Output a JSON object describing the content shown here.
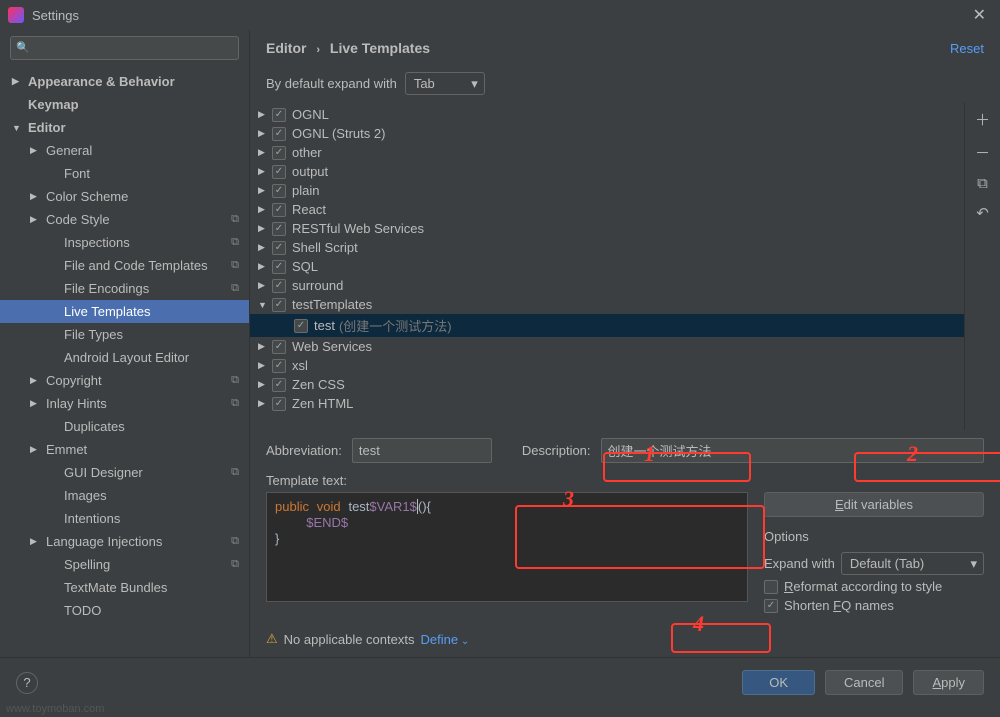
{
  "window": {
    "title": "Settings"
  },
  "search": {
    "placeholder": ""
  },
  "sidebar": {
    "items": [
      {
        "label": "Appearance & Behavior",
        "indent": 0,
        "bold": true,
        "arrow": "collapsed"
      },
      {
        "label": "Keymap",
        "indent": 0,
        "bold": true
      },
      {
        "label": "Editor",
        "indent": 0,
        "bold": true,
        "arrow": "expanded"
      },
      {
        "label": "General",
        "indent": 1,
        "arrow": "collapsed"
      },
      {
        "label": "Font",
        "indent": 2
      },
      {
        "label": "Color Scheme",
        "indent": 1,
        "arrow": "collapsed"
      },
      {
        "label": "Code Style",
        "indent": 1,
        "arrow": "collapsed",
        "copy": true
      },
      {
        "label": "Inspections",
        "indent": 2,
        "copy": true
      },
      {
        "label": "File and Code Templates",
        "indent": 2,
        "copy": true
      },
      {
        "label": "File Encodings",
        "indent": 2,
        "copy": true
      },
      {
        "label": "Live Templates",
        "indent": 2,
        "selected": true
      },
      {
        "label": "File Types",
        "indent": 2
      },
      {
        "label": "Android Layout Editor",
        "indent": 2
      },
      {
        "label": "Copyright",
        "indent": 1,
        "arrow": "collapsed",
        "copy": true
      },
      {
        "label": "Inlay Hints",
        "indent": 1,
        "arrow": "collapsed",
        "copy": true
      },
      {
        "label": "Duplicates",
        "indent": 2
      },
      {
        "label": "Emmet",
        "indent": 1,
        "arrow": "collapsed"
      },
      {
        "label": "GUI Designer",
        "indent": 2,
        "copy": true
      },
      {
        "label": "Images",
        "indent": 2
      },
      {
        "label": "Intentions",
        "indent": 2
      },
      {
        "label": "Language Injections",
        "indent": 1,
        "arrow": "collapsed",
        "copy": true
      },
      {
        "label": "Spelling",
        "indent": 2,
        "copy": true
      },
      {
        "label": "TextMate Bundles",
        "indent": 2
      },
      {
        "label": "TODO",
        "indent": 2
      }
    ]
  },
  "breadcrumb": {
    "parent": "Editor",
    "current": "Live Templates"
  },
  "reset": "Reset",
  "expand": {
    "label": "By default expand with",
    "value": "Tab"
  },
  "templates": [
    {
      "label": "OGNL",
      "arrow": "collapsed",
      "checked": true
    },
    {
      "label": "OGNL (Struts 2)",
      "arrow": "collapsed",
      "checked": true
    },
    {
      "label": "other",
      "arrow": "collapsed",
      "checked": true
    },
    {
      "label": "output",
      "arrow": "collapsed",
      "checked": true
    },
    {
      "label": "plain",
      "arrow": "collapsed",
      "checked": true
    },
    {
      "label": "React",
      "arrow": "collapsed",
      "checked": true
    },
    {
      "label": "RESTful Web Services",
      "arrow": "collapsed",
      "checked": true
    },
    {
      "label": "Shell Script",
      "arrow": "collapsed",
      "checked": true
    },
    {
      "label": "SQL",
      "arrow": "collapsed",
      "checked": true
    },
    {
      "label": "surround",
      "arrow": "collapsed",
      "checked": true
    },
    {
      "label": "testTemplates",
      "arrow": "expanded",
      "checked": true
    },
    {
      "label": "test",
      "desc": "(创建一个测试方法)",
      "checked": true,
      "indent": true,
      "selected": true
    },
    {
      "label": "Web Services",
      "arrow": "collapsed",
      "checked": true
    },
    {
      "label": "xsl",
      "arrow": "collapsed",
      "checked": true
    },
    {
      "label": "Zen CSS",
      "arrow": "collapsed",
      "checked": true
    },
    {
      "label": "Zen HTML",
      "arrow": "collapsed",
      "checked": true
    }
  ],
  "form": {
    "abbrev_label": "Abbreviation:",
    "abbrev_value": "test",
    "desc_label": "Description:",
    "desc_value": "创建一个测试方法",
    "template_label": "Template text:",
    "template_code": {
      "kw1": "public",
      "kw2": "void",
      "name": "test",
      "var1": "$VAR1$",
      "paren": "(){",
      "var2": "$END$",
      "close": "}"
    },
    "edit_vars": "Edit variables",
    "options_title": "Options",
    "expand_with": "Expand with",
    "expand_value": "Default (Tab)",
    "reformat": "Reformat according to style",
    "shorten": "Shorten FQ names"
  },
  "context": {
    "warning": "No applicable contexts",
    "define": "Define"
  },
  "footer": {
    "ok": "OK",
    "cancel": "Cancel",
    "apply": "Apply"
  },
  "annotations": {
    "n1": "1",
    "n2": "2",
    "n3": "3",
    "n4": "4"
  },
  "watermark": "www.toymoban.com"
}
